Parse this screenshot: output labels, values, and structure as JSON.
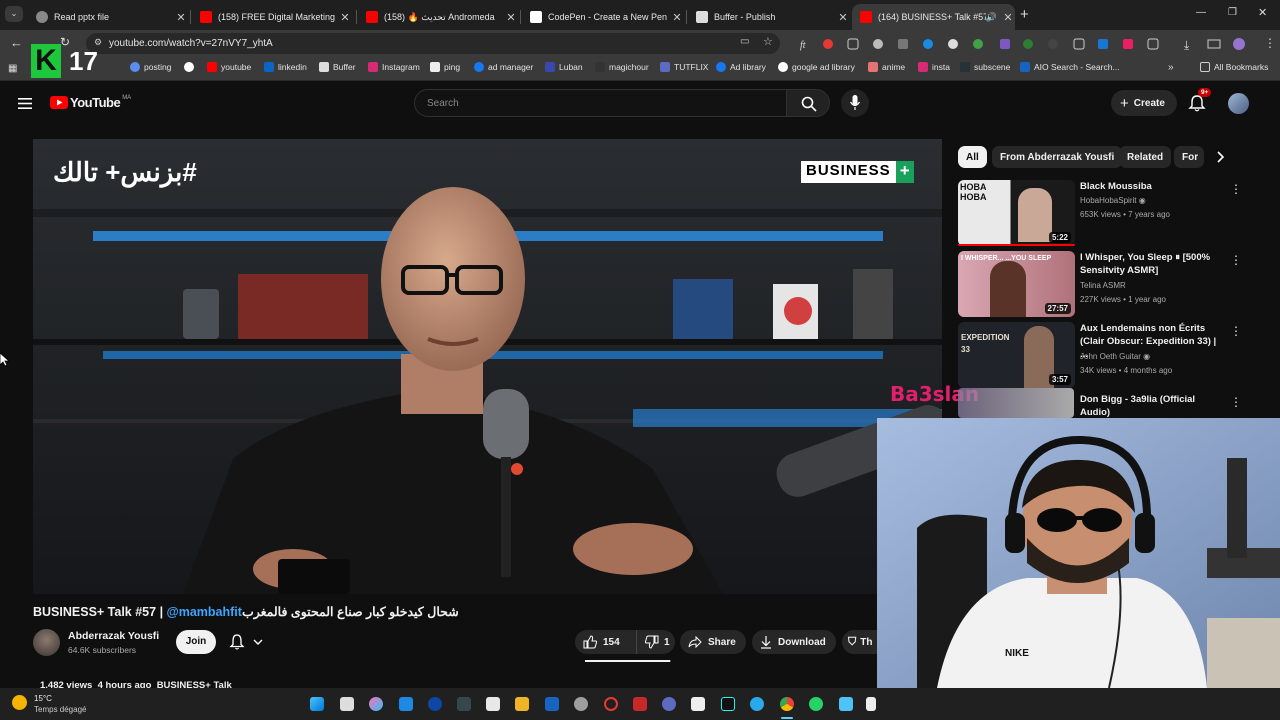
{
  "browser": {
    "tabs": [
      {
        "title": "Read pptx file",
        "active": false
      },
      {
        "title": "(158) FREE Digital Marketing Co",
        "active": false
      },
      {
        "title": "Andromeda تحديث 🔥 (158)",
        "active": false
      },
      {
        "title": "CodePen - Create a New Pen",
        "active": false
      },
      {
        "title": "Buffer - Publish",
        "active": false
      },
      {
        "title": "(164) BUSINESS+ Talk #57 |",
        "active": true
      }
    ],
    "new_tab": "+",
    "url": "youtube.com/watch?v=27nVY7_yhtA",
    "bookmarks": [
      "posting",
      "youtube",
      "linkedin",
      "Buffer",
      "Instagram",
      "ping",
      "ad manager",
      "Luban",
      "magichour",
      "TUTFLIX",
      "Ad library",
      "google ad library",
      "anime",
      "insta",
      "subscene",
      "AIO Search - Search..."
    ],
    "all_bookmarks": "All Bookmarks",
    "overlay_number": "17",
    "overlay_letter": "K"
  },
  "youtube": {
    "logo_text": "YouTube",
    "region": "MA",
    "search_placeholder": "Search",
    "create_label": "Create",
    "notif_badge": "9+"
  },
  "video": {
    "overlay_arabic": "#بزنس+ تالك",
    "brand": "BUSINESS",
    "brand_plus": "+",
    "title_prefix": "BUSINESS+ Talk #57 | ",
    "title_mention": "@mambahfit",
    "title_arabic": "شحال كيدخلو كبار صناع المحتوى فالمغرب",
    "channel": "Abderrazak Yousfi",
    "subscribers": "64.6K subscribers",
    "join": "Join",
    "likes": "154",
    "dislikes": "1",
    "share": "Share",
    "download": "Download",
    "thanks": "Th",
    "views_line": "1,482 views  4 hours ago  BUSINESS+ Talk"
  },
  "chips": [
    "All",
    "From Abderrazak Yousfi",
    "Related",
    "For"
  ],
  "recommendations": [
    {
      "title": "Black Moussiba",
      "channel": "HobaHobaSpirit",
      "meta": "653K views • 7 years ago",
      "duration": "5:22",
      "thumb_text": "HOBA HOBA"
    },
    {
      "title": "I Whisper, You Sleep ⏸ [500% Sensitvity ASMR]",
      "channel": "Telina ASMR",
      "meta": "227K views • 1 year ago",
      "duration": "27:57",
      "thumb_text": "I WHISPER... ...YOU SLEEP"
    },
    {
      "title": "Aux Lendemains non Écrits (Clair Obscur: Expedition 33) | ...",
      "channel": "John Oeth Guitar",
      "meta": "34K views • 4 months ago",
      "duration": "3:57",
      "thumb_text": "EXPEDITION 33"
    },
    {
      "title": "Don Bigg - 3a9lia (Official Audio)",
      "channel": "",
      "meta": "",
      "duration": "",
      "thumb_text": ""
    }
  ],
  "streamer": {
    "name": "Ba3slan",
    "shirt": "NIKE"
  },
  "taskbar": {
    "temp": "15°C",
    "weather": "Temps dégagé"
  },
  "colors": {
    "yt_red": "#ff0000",
    "link_blue": "#3ea6ff",
    "overlay_green": "#1ec83c",
    "streamer_name": "#e0206c"
  }
}
